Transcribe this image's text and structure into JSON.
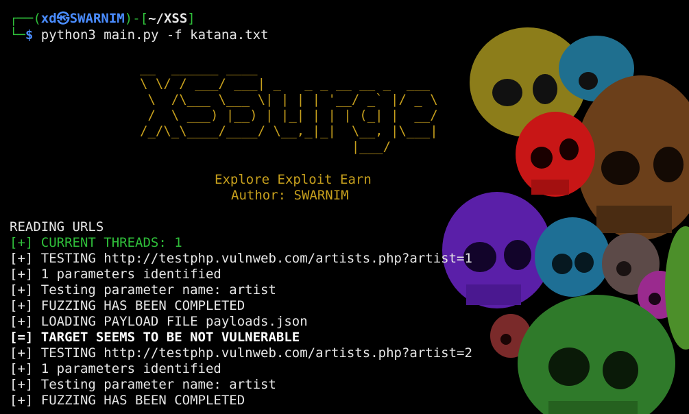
{
  "prompt": {
    "user": "xd",
    "host": "SWARNIM",
    "path": "~/XSS",
    "symbol": "$",
    "command": "python3 main.py -f katana.txt"
  },
  "banner": {
    "art": "__  ______ ____\n\\ \\/ / ___/ ___| _   _ _ __ __ _  ___\n \\  /\\___ \\___ \\| | | | '__/ _` |/ _ \\\n /  \\ ___) |__) | |_| | | | (_| |  __/\n/_/\\_\\____/____/ \\__,_|_|  \\__, |\\___|\n                           |___/",
    "tagline": "Explore Exploit Earn",
    "author": "Author: SWARNIM"
  },
  "output": [
    {
      "text": "READING URLS",
      "style": "plain"
    },
    {
      "text": "[+] CURRENT THREADS: 1",
      "style": "green"
    },
    {
      "text": "[+] TESTING http://testphp.vulnweb.com/artists.php?artist=1",
      "style": "plain"
    },
    {
      "text": "[+] 1 parameters identified",
      "style": "plain"
    },
    {
      "text": "[+] Testing parameter name: artist",
      "style": "plain"
    },
    {
      "text": "[+] FUZZING HAS BEEN COMPLETED",
      "style": "plain"
    },
    {
      "text": "[+] LOADING PAYLOAD FILE payloads.json",
      "style": "plain"
    },
    {
      "text": "[=] TARGET SEEMS TO BE NOT VULNERABLE",
      "style": "bold"
    },
    {
      "text": "[+] TESTING http://testphp.vulnweb.com/artists.php?artist=2",
      "style": "plain"
    },
    {
      "text": "[+] 1 parameters identified",
      "style": "plain"
    },
    {
      "text": "[+] Testing parameter name: artist",
      "style": "plain"
    },
    {
      "text": "[+] FUZZING HAS BEEN COMPLETED",
      "style": "plain"
    }
  ],
  "colors": {
    "background": "#000000",
    "prompt_green": "#2fbf3a",
    "host_blue": "#4a8cff",
    "banner_gold": "#c7a01d",
    "text": "#e6e6e6"
  }
}
